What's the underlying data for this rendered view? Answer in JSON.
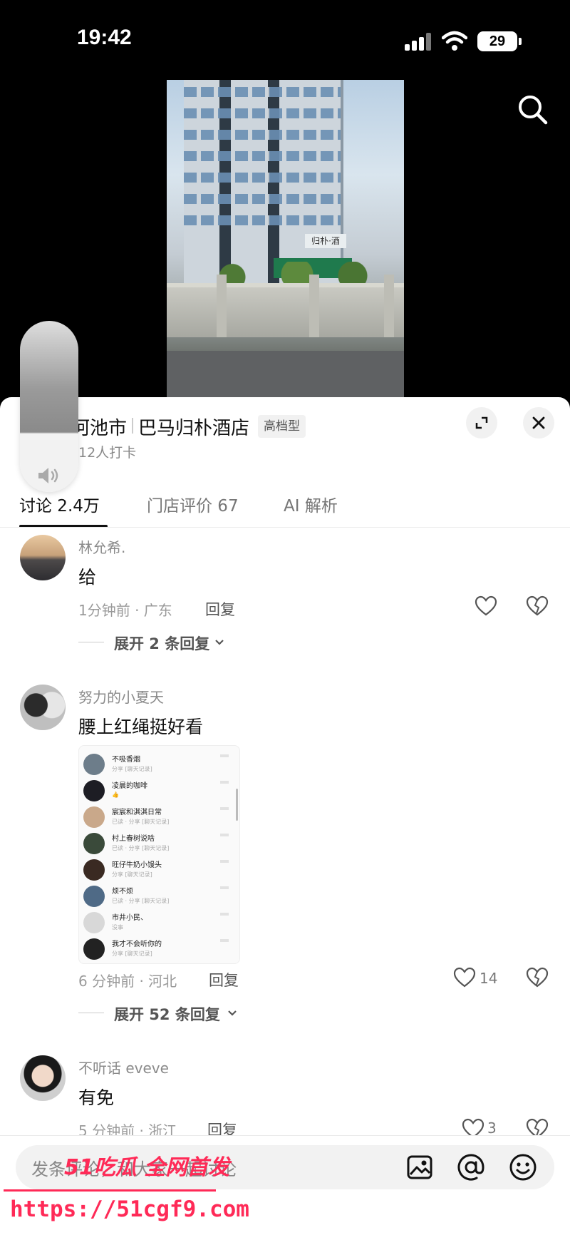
{
  "status_bar": {
    "time": "19:42",
    "battery": "29"
  },
  "location": {
    "city": "河池市",
    "hotel": "巴马归朴酒店",
    "tag": "高档型",
    "checkins": "12人打卡"
  },
  "video": {
    "sign_text": "归朴·酒"
  },
  "tabs": [
    {
      "label": "讨论 2.4万",
      "active": true
    },
    {
      "label": "门店评价 67",
      "active": false
    },
    {
      "label": "AI 解析",
      "active": false
    }
  ],
  "comments": [
    {
      "user": "林允希.",
      "text": "给",
      "time_region": "1分钟前 · 广东",
      "reply": "回复",
      "likes": "",
      "expand": "展开 2 条回复"
    },
    {
      "user": "努力的小夏天",
      "text": "腰上红绳挺好看",
      "time_region": "6 分钟前 · 河北",
      "reply": "回复",
      "likes": "14",
      "expand": "展开 52 条回复",
      "screenshot_rows": [
        {
          "name": "不吸香烟",
          "sub": "分享 [聊天记录]"
        },
        {
          "name": "凌晨的咖啡",
          "sub": "👍"
        },
        {
          "name": "宸宸和淇淇日常",
          "sub": "已读 · 分享 [聊天记录]"
        },
        {
          "name": "村上春树说啥",
          "sub": "已读 · 分享 [聊天记录]"
        },
        {
          "name": "旺仔牛奶小馒头",
          "sub": "分享 [聊天记录]"
        },
        {
          "name": "烦不烦",
          "sub": "已读 · 分享 [聊天记录]"
        },
        {
          "name": "市井小民、",
          "sub": "没事"
        },
        {
          "name": "我才不会听你的",
          "sub": "分享 [聊天记录]"
        }
      ]
    },
    {
      "user": "不听话 eveve",
      "text": "有免",
      "time_region": "5 分钟前 · 浙江",
      "reply": "回复",
      "likes": "3",
      "expand": ""
    }
  ],
  "input": {
    "placeholder": "发条评论，和大家一起讨论"
  },
  "watermark": {
    "text": "51吃瓜 全网首发",
    "url": "https://51cgf9.com"
  },
  "colors": {
    "accent": "#ff2a57",
    "text": "#111111",
    "muted": "#8a8a8a"
  }
}
